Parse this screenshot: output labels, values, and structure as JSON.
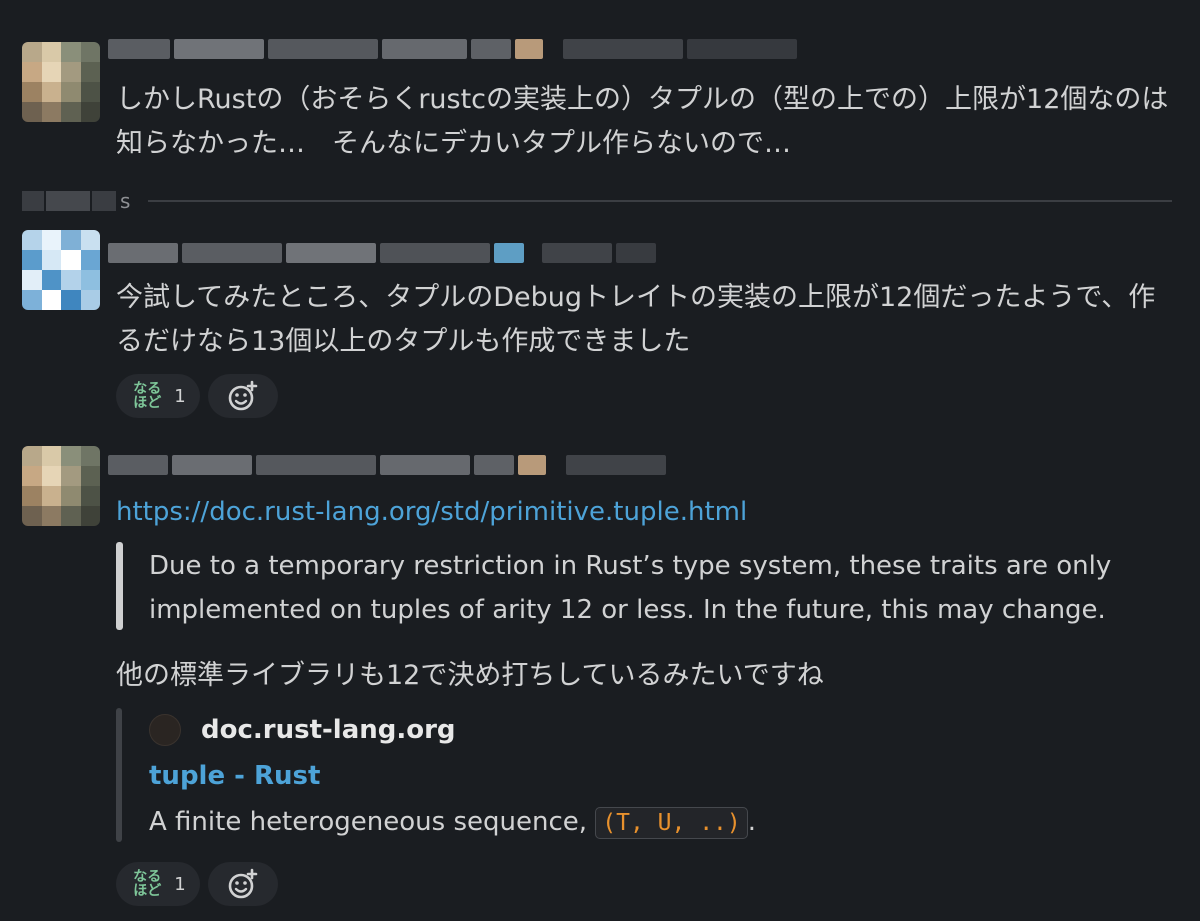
{
  "messages": [
    {
      "text": "しかしRustの（おそらくrustcの実装上の）タプルの（型の上での）上限が12個なのは知らなかった…　そんなにデカいタプル作らないので…"
    },
    {
      "text": "今試してみたところ、タプルのDebugトレイトの実装の上限が12個だったようで、作るだけなら13個以上のタプルも作成できました",
      "reaction": {
        "emoji": "なるほど",
        "count": "1"
      }
    },
    {
      "link": "https://doc.rust-lang.org/std/primitive.tuple.html",
      "quote": "Due to a temporary restriction in Rust’s type system, these traits are only implemented on tuples of arity 12 or less. In the future, this may change.",
      "text": "他の標準ライブラリも12で決め打ちしているみたいですね",
      "unfurl": {
        "site": "doc.rust-lang.org",
        "title": "tuple - Rust",
        "description_before": "A finite heterogeneous sequence, ",
        "code": "(T, U, ..)",
        "description_after": "."
      },
      "reaction": {
        "emoji": "なるほど",
        "count": "1"
      }
    }
  ],
  "divider": {
    "label": "s"
  },
  "icons": {
    "add_reaction": "add-reaction-icon",
    "favicon": "favicon-icon"
  },
  "colors": {
    "background": "#1a1d21",
    "link": "#4da3d8",
    "code": "#e8912d",
    "reaction_green": "#7ec699"
  }
}
